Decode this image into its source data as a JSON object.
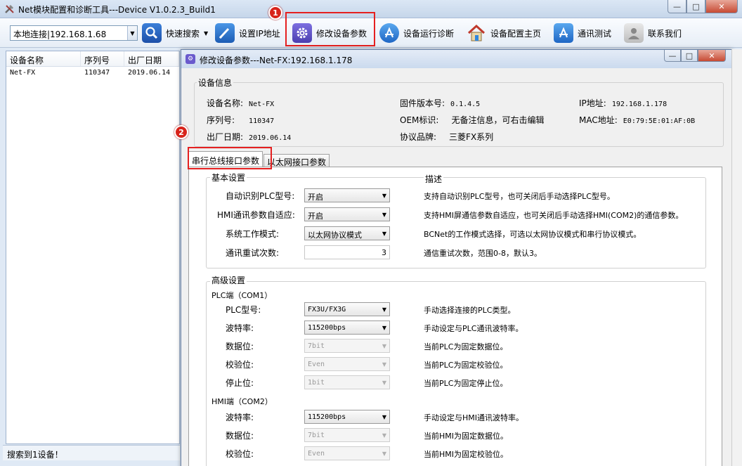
{
  "window": {
    "title": "Net模块配置和诊断工具---Device V1.0.2.3_Build1",
    "controls": [
      "—",
      "□",
      "✕"
    ]
  },
  "toolbar": {
    "connection_value": "本地连接|192.168.1.68",
    "quick_search": "快速搜索",
    "set_ip": "设置IP地址",
    "modify_params": "修改设备参数",
    "run_diag": "设备运行诊断",
    "config_home": "设备配置主页",
    "comm_test": "通讯测试",
    "contact_us": "联系我们"
  },
  "annotations": {
    "badge1": "1",
    "badge2": "2"
  },
  "device_list": {
    "columns": [
      "设备名称",
      "序列号",
      "出厂日期"
    ],
    "rows": [
      {
        "name": "Net-FX",
        "serial": "110347",
        "date": "2019.06.14"
      }
    ]
  },
  "status": {
    "text": "搜索到1设备！"
  },
  "dialog": {
    "title": "修改设备参数---Net-FX:192.168.1.178",
    "info_group": "设备信息",
    "info": {
      "name_label": "设备名称:",
      "name_value": "Net-FX",
      "serial_label": "序列号:",
      "serial_value": "110347",
      "date_label": "出厂日期:",
      "date_value": "2019.06.14",
      "fw_label": "固件版本号:",
      "fw_value": "0.1.4.5",
      "oem_label": "OEM标识:",
      "oem_value": "无备注信息，可右击编辑",
      "brand_label": "协议品牌:",
      "brand_value": "三菱FX系列",
      "ip_label": "IP地址:",
      "ip_value": "192.168.1.178",
      "mac_label": "MAC地址:",
      "mac_value": "E0:79:5E:01:AF:0B"
    },
    "tabs": [
      "串行总线接口参数",
      "以太网接口参数"
    ],
    "basic": {
      "title": "基本设置",
      "desc_title": "描述",
      "auto_plc_label": "自动识别PLC型号:",
      "auto_plc_value": "开启",
      "auto_plc_desc": "支持自动识别PLC型号，也可关闭后手动选择PLC型号。",
      "hmi_label": "HMI通讯参数自适应:",
      "hmi_value": "开启",
      "hmi_desc": "支持HMI屏通信参数自适应，也可关闭后手动选择HMI(COM2)的通信参数。",
      "mode_label": "系统工作模式:",
      "mode_value": "以太网协议模式",
      "mode_desc": "BCNet的工作模式选择，可选以太网协议模式和串行协议模式。",
      "retry_label": "通讯重试次数:",
      "retry_value": "3",
      "retry_desc": "通信重试次数，范围0-8，默认3。"
    },
    "advanced": {
      "title": "高级设置",
      "plc_port": "PLC端（COM1）",
      "plc_model_label": "PLC型号:",
      "plc_model_value": "FX3U/FX3G",
      "plc_model_desc": "手动选择连接的PLC类型。",
      "plc_baud_label": "波特率:",
      "plc_baud_value": "115200bps",
      "plc_baud_desc": "手动设定与PLC通讯波特率。",
      "plc_data_label": "数据位:",
      "plc_data_value": "7bit",
      "plc_data_desc": "当前PLC为固定数据位。",
      "plc_parity_label": "校验位:",
      "plc_parity_value": "Even",
      "plc_parity_desc": "当前PLC为固定校验位。",
      "plc_stop_label": "停止位:",
      "plc_stop_value": "1bit",
      "plc_stop_desc": "当前PLC为固定停止位。",
      "hmi_port": "HMI端（COM2）",
      "hmi_baud_label": "波特率:",
      "hmi_baud_value": "115200bps",
      "hmi_baud_desc": "手动设定与HMI通讯波特率。",
      "hmi_data_label": "数据位:",
      "hmi_data_value": "7bit",
      "hmi_data_desc": "当前HMI为固定数据位。",
      "hmi_parity_label": "校验位:",
      "hmi_parity_value": "Even",
      "hmi_parity_desc": "当前HMI为固定校验位。"
    }
  }
}
